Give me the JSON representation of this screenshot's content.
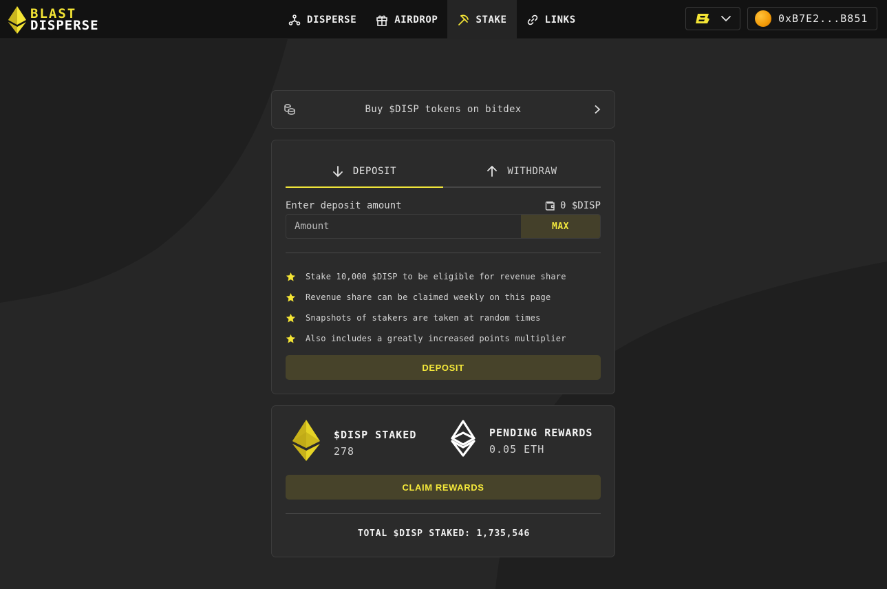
{
  "brand": {
    "line1": "BLAST",
    "line2": "DISPERSE",
    "accent": "#f4e535"
  },
  "nav": {
    "items": [
      {
        "label": "DISPERSE",
        "icon": "disperse-icon"
      },
      {
        "label": "AIRDROP",
        "icon": "gift-icon"
      },
      {
        "label": "STAKE",
        "icon": "pickaxe-icon",
        "active": true
      },
      {
        "label": "LINKS",
        "icon": "link-icon"
      }
    ]
  },
  "header": {
    "chain_icon": "blast-chain-icon",
    "wallet_address": "0xB7E2...B851"
  },
  "buy": {
    "label": "Buy $DISP tokens on bitdex"
  },
  "deposit": {
    "tabs": [
      {
        "label": "DEPOSIT",
        "active": true
      },
      {
        "label": "WITHDRAW",
        "active": false
      }
    ],
    "amount_label": "Enter deposit amount",
    "balance": "0 $DISP",
    "amount_placeholder": "Amount",
    "max_label": "MAX",
    "features": [
      "Stake 10,000 $DISP to be eligible for revenue share",
      "Revenue share can be claimed weekly on this page",
      "Snapshots of stakers are taken at random times",
      "Also includes a greatly increased points multiplier"
    ],
    "button_label": "DEPOSIT"
  },
  "stake": {
    "staked_label": "$DISP STAKED",
    "staked_value": "278",
    "rewards_label": "PENDING REWARDS",
    "rewards_value": "0.05 ETH",
    "claim_label": "CLAIM REWARDS",
    "total_label": "TOTAL $DISP STAKED: 1,735,546"
  }
}
